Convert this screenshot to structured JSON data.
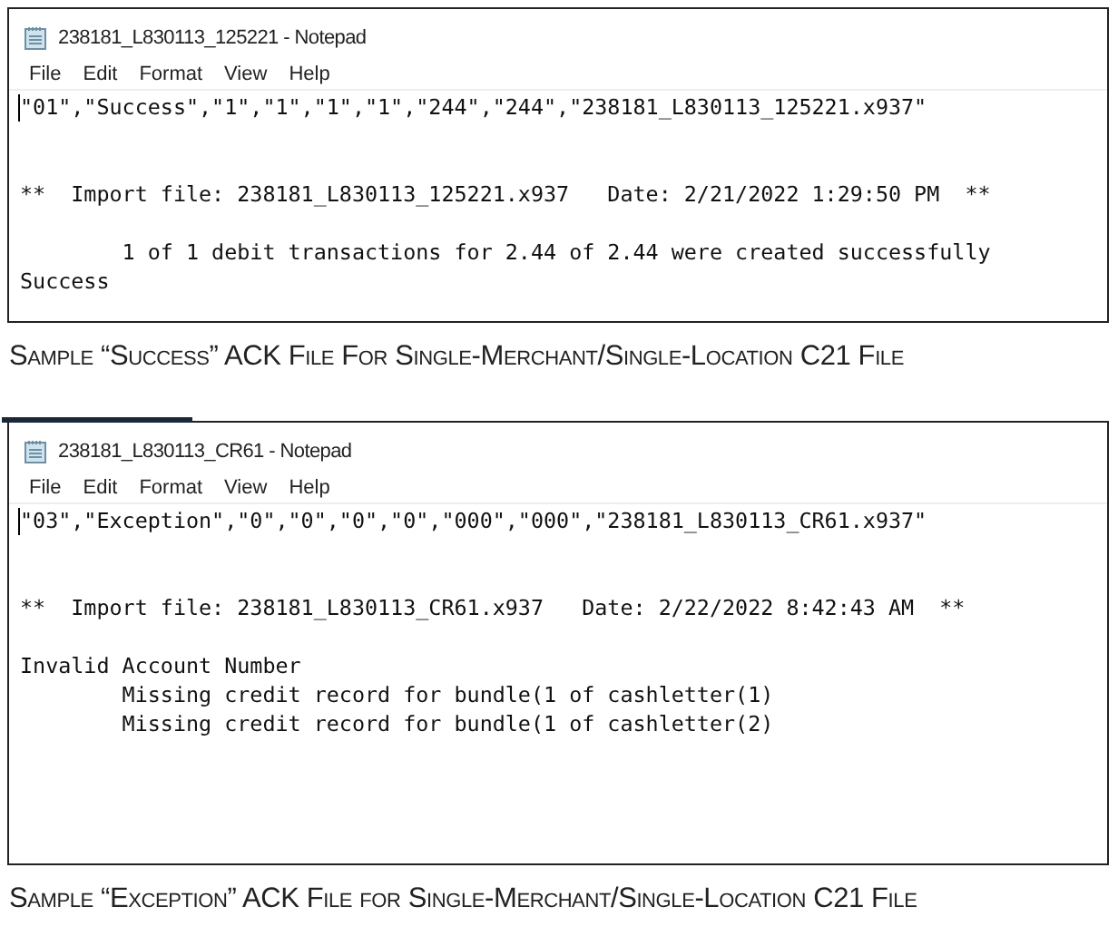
{
  "figures": [
    {
      "window": {
        "title": "238181_L830113_125221 - Notepad",
        "menu": [
          "File",
          "Edit",
          "Format",
          "View",
          "Help"
        ],
        "text": "\"01\",\"Success\",\"1\",\"1\",\"1\",\"1\",\"244\",\"244\",\"238181_L830113_125221.x937\"\n\n\n**  Import file: 238181_L830113_125221.x937   Date: 2/21/2022 1:29:50 PM  **\n\n        1 of 1 debit transactions for 2.44 of 2.44 were created successfully\nSuccess"
      },
      "caption": "Sample “Success” ACK File For Single-Merchant/Single-Location C21 File"
    },
    {
      "window": {
        "title": "238181_L830113_CR61 - Notepad",
        "menu": [
          "File",
          "Edit",
          "Format",
          "View",
          "Help"
        ],
        "text": "\"03\",\"Exception\",\"0\",\"0\",\"0\",\"0\",\"000\",\"000\",\"238181_L830113_CR61.x937\"\n\n\n**  Import file: 238181_L830113_CR61.x937   Date: 2/22/2022 8:42:43 AM  **\n\nInvalid Account Number\n        Missing credit record for bundle(1 of cashletter(1)\n        Missing credit record for bundle(1 of cashletter(2)"
      },
      "caption": "Sample “Exception” ACK File for Single-Merchant/Single-Location C21 File"
    }
  ]
}
